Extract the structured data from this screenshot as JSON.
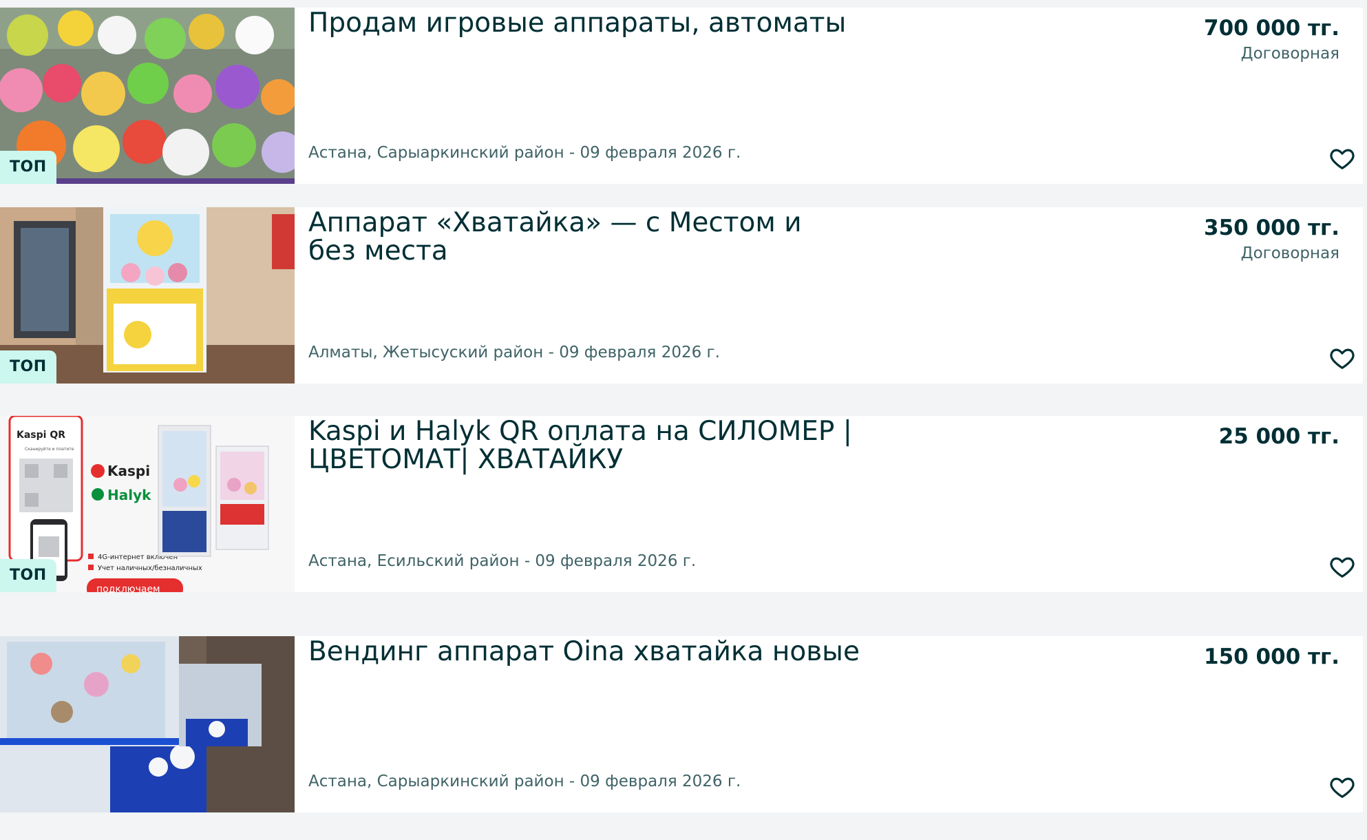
{
  "listings": [
    {
      "badge": "ТОП",
      "title": "Продам игровые аппараты, автоматы",
      "price": "700 000 тг.",
      "negotiable": "Договорная",
      "location_date": "Астана, Сарыаркинский район - 09 февраля 2026 г.",
      "favorite_icon": "heart-outline-icon"
    },
    {
      "badge": "ТОП",
      "title": "Аппарат «Хватайка» — с Местом и без места",
      "price": "350 000 тг.",
      "negotiable": "Договорная",
      "location_date": "Алматы, Жетысуский район - 09 февраля 2026 г.",
      "favorite_icon": "heart-outline-icon"
    },
    {
      "badge": "ТОП",
      "title": "Kaspi и Halyk QR оплата на СИЛОМЕР | ЦВЕТОМАТ| ХВАТАЙКУ",
      "price": "25 000 тг.",
      "negotiable": "",
      "location_date": "Астана, Есильский район - 09 февраля 2026 г.",
      "favorite_icon": "heart-outline-icon",
      "image_text": {
        "qr_label": "Kaspi QR",
        "qr_sub": "Сканируйте и платите",
        "kaspi": "Kaspi",
        "halyk": "Halyk",
        "bullet1": "4G-интернет включен",
        "bullet2": "Учет наличных/безналичных",
        "cta": "подключаем"
      }
    },
    {
      "badge": "",
      "title": "Вендинг аппарат Oina хватайка новые",
      "price": "150 000 тг.",
      "negotiable": "",
      "location_date": "Астана, Сарыаркинский район - 09 февраля 2026 г.",
      "favorite_icon": "heart-outline-icon"
    }
  ],
  "colors": {
    "text_primary": "#002f34",
    "text_secondary": "#406367",
    "badge_bg": "#cbf7ee",
    "page_bg": "#f2f4f5",
    "kaspi_red": "#e52e2e",
    "halyk_green": "#0a8f3c"
  }
}
